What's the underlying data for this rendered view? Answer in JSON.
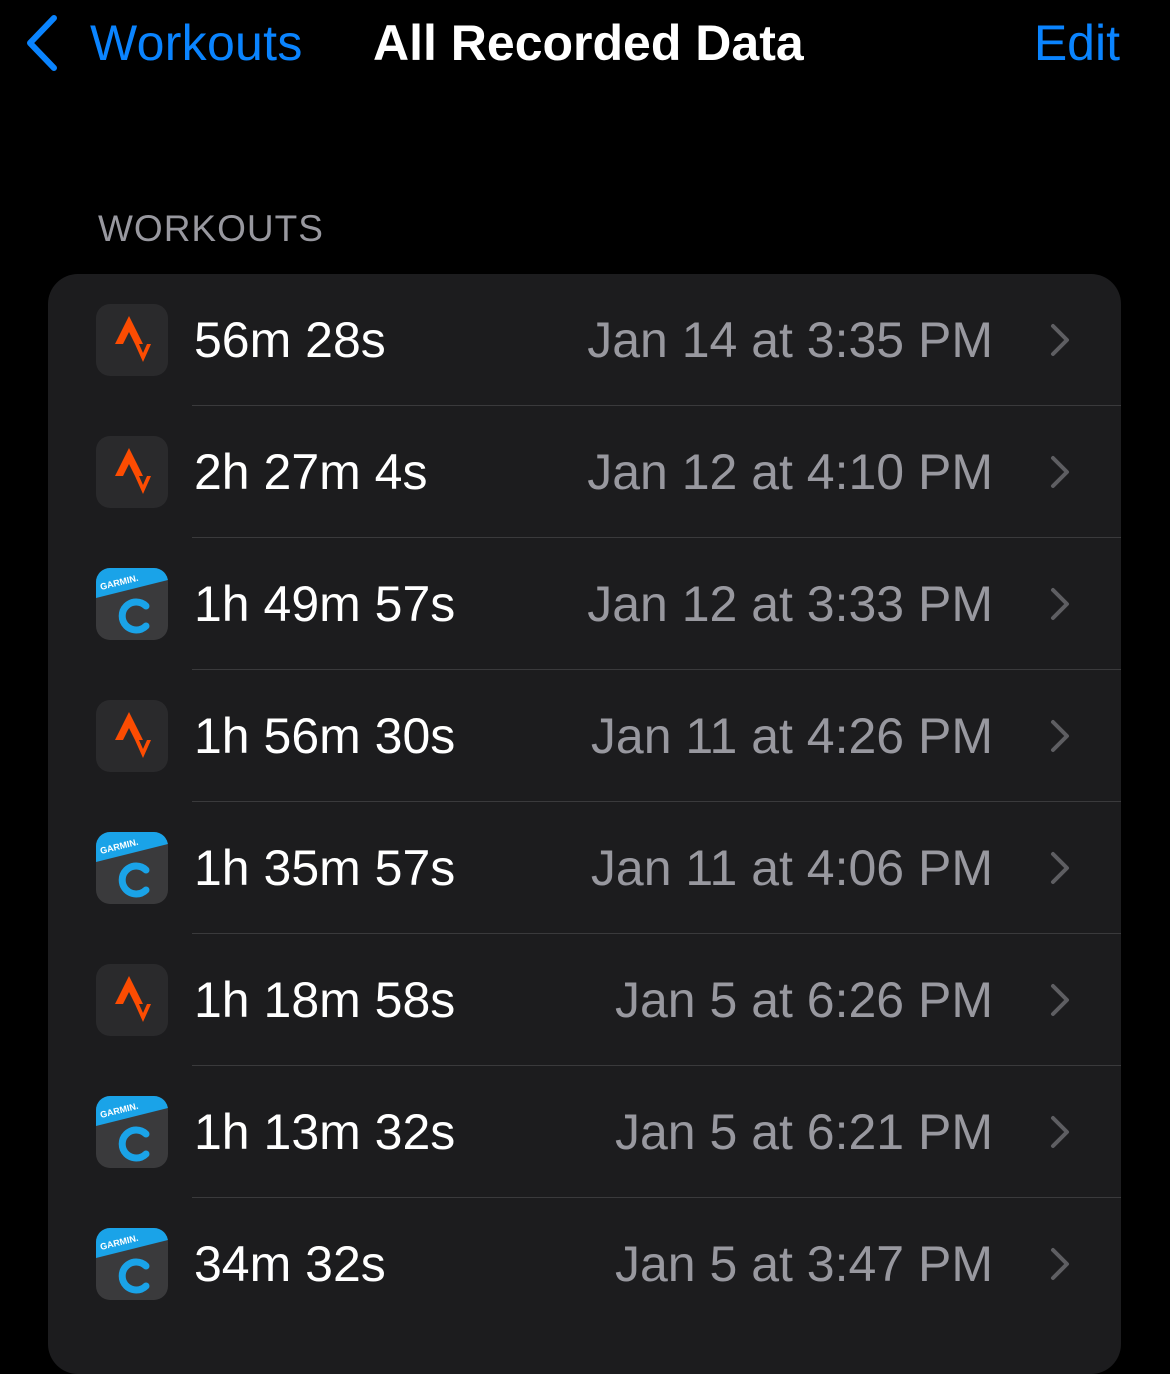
{
  "nav": {
    "back_label": "Workouts",
    "title": "All Recorded Data",
    "edit_label": "Edit"
  },
  "section": {
    "header": "WORKOUTS"
  },
  "colors": {
    "accent": "#0a84ff",
    "strava": "#fc4c02",
    "garmin_blue": "#1aa3e8"
  },
  "workouts": [
    {
      "source": "strava-icon",
      "duration": "56m 28s",
      "date": "Jan 14 at 3:35 PM"
    },
    {
      "source": "strava-icon",
      "duration": "2h 27m 4s",
      "date": "Jan 12 at 4:10 PM"
    },
    {
      "source": "garmin-connect-icon",
      "icon_text": "GARMIN.",
      "duration": "1h 49m 57s",
      "date": "Jan 12 at 3:33 PM"
    },
    {
      "source": "strava-icon",
      "duration": "1h 56m 30s",
      "date": "Jan 11 at 4:26 PM"
    },
    {
      "source": "garmin-connect-icon",
      "icon_text": "GARMIN.",
      "duration": "1h 35m 57s",
      "date": "Jan 11 at 4:06 PM"
    },
    {
      "source": "strava-icon",
      "duration": "1h 18m 58s",
      "date": "Jan 5 at 6:26 PM"
    },
    {
      "source": "garmin-connect-icon",
      "icon_text": "GARMIN.",
      "duration": "1h 13m 32s",
      "date": "Jan 5 at 6:21 PM"
    },
    {
      "source": "garmin-connect-icon",
      "icon_text": "GARMIN.",
      "duration": "34m 32s",
      "date": "Jan 5 at 3:47 PM"
    }
  ]
}
